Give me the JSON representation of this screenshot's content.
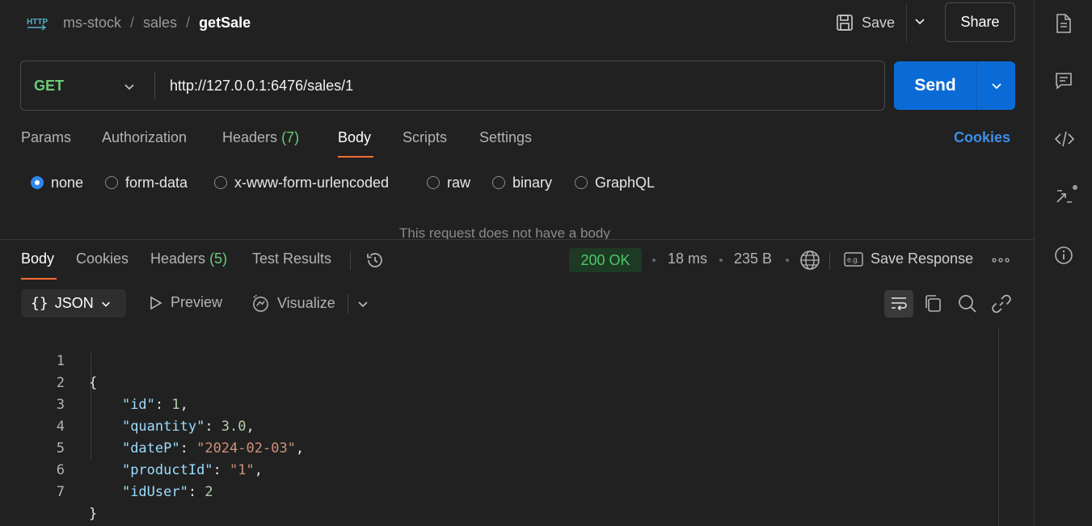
{
  "header": {
    "breadcrumb": [
      "ms-stock",
      "sales",
      "getSale"
    ],
    "save_label": "Save",
    "share_label": "Share"
  },
  "request": {
    "method": "GET",
    "url": "http://127.0.0.1:6476/sales/1",
    "send_label": "Send",
    "tabs": [
      {
        "label": "Params"
      },
      {
        "label": "Authorization"
      },
      {
        "label": "Headers",
        "count": "(7)"
      },
      {
        "label": "Body"
      },
      {
        "label": "Scripts"
      },
      {
        "label": "Settings"
      }
    ],
    "active_tab": "Body",
    "cookies_label": "Cookies",
    "body_types": [
      "none",
      "form-data",
      "x-www-form-urlencoded",
      "raw",
      "binary",
      "GraphQL"
    ],
    "selected_body_type": "none",
    "empty_message": "This request does not have a body"
  },
  "response": {
    "tabs": [
      {
        "label": "Body"
      },
      {
        "label": "Cookies"
      },
      {
        "label": "Headers",
        "count": "(5)"
      },
      {
        "label": "Test Results"
      }
    ],
    "active_tab": "Body",
    "status": "200 OK",
    "time": "18 ms",
    "size": "235 B",
    "save_response_label": "Save Response",
    "format": "JSON",
    "preview_label": "Preview",
    "visualize_label": "Visualize",
    "body_lines": [
      "{",
      "    \"id\": 1,",
      "    \"quantity\": 3.0,",
      "    \"dateP\": \"2024-02-03\",",
      "    \"productId\": \"1\",",
      "    \"idUser\": 2",
      "}"
    ],
    "line_numbers": [
      "1",
      "2",
      "3",
      "4",
      "5",
      "6",
      "7"
    ]
  },
  "colors": {
    "accent": "#ff6c37",
    "send": "#0b6bd6",
    "method_get": "#6bcb77",
    "status_ok": "#4cc767",
    "link": "#3b8fe8"
  }
}
